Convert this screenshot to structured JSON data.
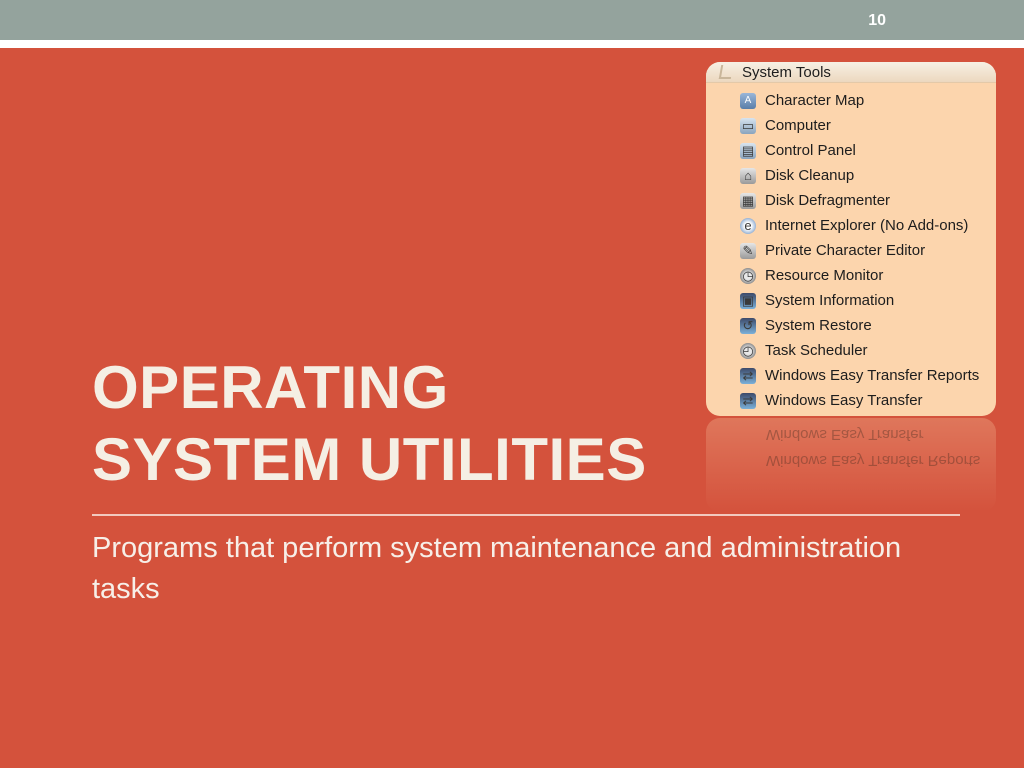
{
  "slide": {
    "number": "10",
    "title_line1": "OPERATING",
    "title_line2": "SYSTEM UTILITIES",
    "subtitle": "Programs that perform system maintenance and administration tasks"
  },
  "menu": {
    "header": "System Tools",
    "items": [
      {
        "label": "Character Map",
        "icon": "character-map-icon"
      },
      {
        "label": "Computer",
        "icon": "computer-icon"
      },
      {
        "label": "Control Panel",
        "icon": "control-panel-icon"
      },
      {
        "label": "Disk Cleanup",
        "icon": "disk-cleanup-icon"
      },
      {
        "label": "Disk Defragmenter",
        "icon": "disk-defragmenter-icon"
      },
      {
        "label": "Internet Explorer (No Add-ons)",
        "icon": "internet-explorer-icon"
      },
      {
        "label": "Private Character Editor",
        "icon": "private-character-editor-icon"
      },
      {
        "label": "Resource Monitor",
        "icon": "resource-monitor-icon"
      },
      {
        "label": "System Information",
        "icon": "system-information-icon"
      },
      {
        "label": "System Restore",
        "icon": "system-restore-icon"
      },
      {
        "label": "Task Scheduler",
        "icon": "task-scheduler-icon"
      },
      {
        "label": "Windows Easy Transfer Reports",
        "icon": "windows-easy-transfer-reports-icon"
      },
      {
        "label": "Windows Easy Transfer",
        "icon": "windows-easy-transfer-icon"
      }
    ]
  },
  "colors": {
    "background": "#d4523c",
    "topbar": "#94a39d",
    "menu_background": "#fcd5ad",
    "title_text": "#f5efe4"
  }
}
